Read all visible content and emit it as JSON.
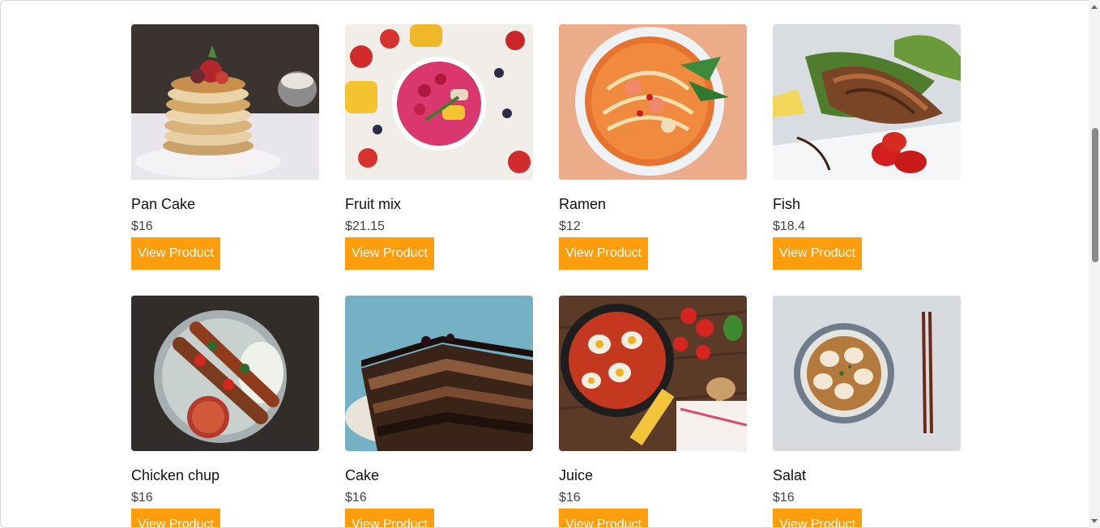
{
  "products": [
    {
      "name": "Pan Cake",
      "price": "$16",
      "button": "View Product",
      "image": "pancake-image"
    },
    {
      "name": "Fruit mix",
      "price": "$21.15",
      "button": "View Product",
      "image": "fruit-bowl-image"
    },
    {
      "name": "Ramen",
      "price": "$12",
      "button": "View Product",
      "image": "ramen-image"
    },
    {
      "name": "Fish",
      "price": "$18.4",
      "button": "View Product",
      "image": "fish-image"
    },
    {
      "name": "Chicken chup",
      "price": "$16",
      "button": "View Product",
      "image": "chicken-skewers-image"
    },
    {
      "name": "Cake",
      "price": "$16",
      "button": "View Product",
      "image": "chocolate-cake-image"
    },
    {
      "name": "Juice",
      "price": "$16",
      "button": "View Product",
      "image": "shakshuka-pan-image"
    },
    {
      "name": "Salat",
      "price": "$16",
      "button": "View Product",
      "image": "dumpling-soup-image"
    }
  ],
  "colors": {
    "button_bg": "#ff9d0d",
    "button_text": "#ffffff",
    "price_text": "#444444"
  }
}
